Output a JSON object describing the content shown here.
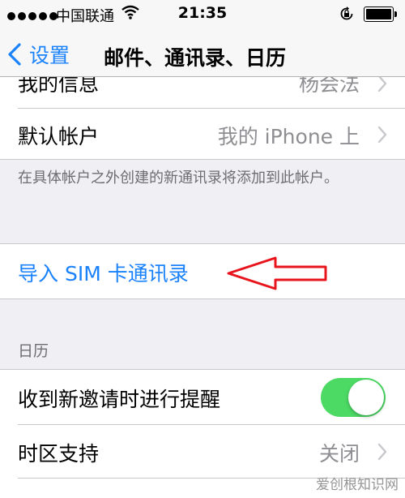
{
  "status_bar": {
    "carrier": "中国联通",
    "time": "21:35"
  },
  "nav": {
    "back_label": "设置",
    "title": "邮件、通讯录、日历"
  },
  "contacts": {
    "partial_row_label": "我的信息",
    "partial_row_value": "杨会法",
    "default_account_label": "默认帐户",
    "default_account_value": "我的 iPhone 上",
    "footer_note": "在具体帐户之外创建的新通讯录将添加到此帐户。",
    "import_sim_label": "导入 SIM 卡通讯录"
  },
  "calendar": {
    "section_header": "日历",
    "invite_alerts_label": "收到新邀请时进行提醒",
    "invite_alerts_on": true,
    "timezone_label": "时区支持",
    "timezone_value": "关闭"
  },
  "colors": {
    "accent_blue": "#1a82fb",
    "toggle_green": "#4cd964",
    "annotation_red": "#e8141c",
    "group_background": "#efeff4"
  },
  "watermark": "爱创根知识网"
}
